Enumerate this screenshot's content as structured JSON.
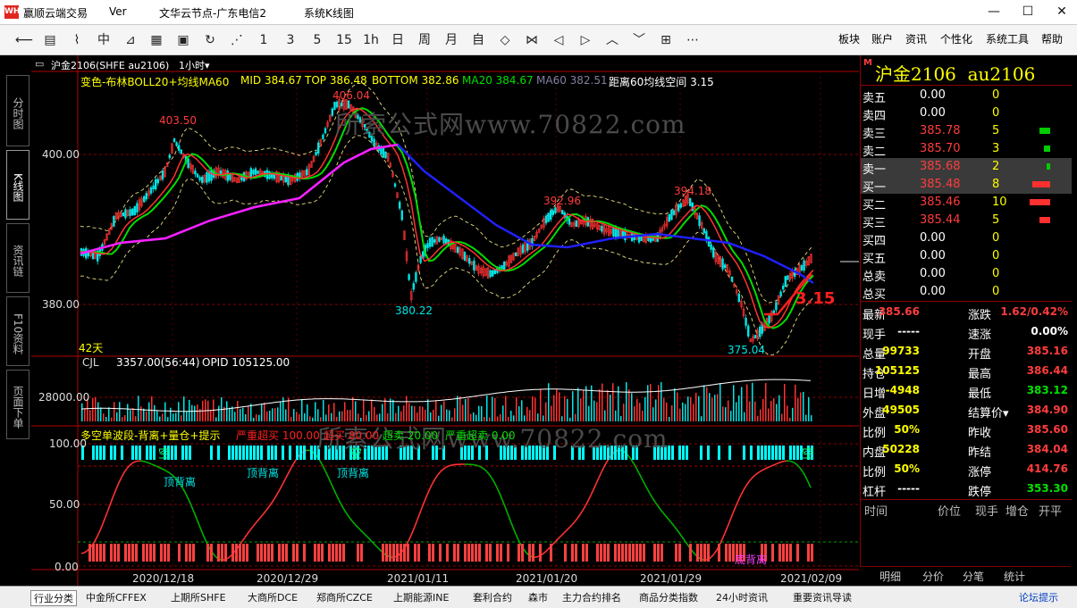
{
  "window": {
    "app_name": "赢顺云端交易",
    "version": "Ver",
    "node": "文华云节点-广东电信2",
    "view": "系统K线图",
    "logo": "WH6"
  },
  "toolbar": {
    "icons": [
      "back-icon",
      "list-icon",
      "line-chart-icon",
      "candle-icon",
      "chart-tool-icon",
      "grid-table-icon",
      "save-icon",
      "refresh-icon",
      "strategy-icon"
    ],
    "periods": [
      "1",
      "3",
      "5",
      "15",
      "1h",
      "日",
      "周",
      "月",
      "自"
    ],
    "nav_icons": [
      "zoom-in-icon",
      "zoom-out-icon",
      "left-icon",
      "right-icon",
      "up-icon",
      "down-icon",
      "layout-icon",
      "more-icon"
    ],
    "more": "⋯",
    "menus": [
      "板块",
      "账户",
      "资讯",
      "个性化",
      "系统工具",
      "帮助"
    ]
  },
  "left_tabs": [
    {
      "label": "分时图"
    },
    {
      "label": "K线图",
      "active": true
    },
    {
      "label": "资讯链"
    },
    {
      "label": "F10资料"
    },
    {
      "label": "页面下单"
    }
  ],
  "chart_header": {
    "symbol": "沪金2106(SHFE au2106)",
    "period": "1小时▾"
  },
  "indicator_line": {
    "name": "变色-布林BOLL20+均线MA60",
    "mid": "MID 384.67",
    "top": "TOP 386.48",
    "bottom": "BOTTOM 382.86",
    "ma20": "MA20 384.67",
    "ma60": "MA60 382.51",
    "dist": "距离60均线空间 3.15"
  },
  "annotations": {
    "p1": "403.50",
    "p2": "406.04",
    "p3": "392.96",
    "p4": "394.18",
    "l1": "380.22",
    "l2": "375.04",
    "dist_big": "3.15",
    "days": "42天"
  },
  "price_axis": [
    "400.00",
    "380.00"
  ],
  "vol_header": {
    "name": "CJL",
    "value": "3357.00(56:44)",
    "opid": "OPID 105125.00"
  },
  "vol_axis": "28000.00",
  "osc_header": {
    "name": "多空单波段-背离+量仓+提示",
    "t1": "严重超买 100.00",
    "t2": "超买 80.00",
    "t3": "超卖 20.00",
    "t4": "严重超卖 0.00"
  },
  "osc_axis": [
    "100.00",
    "50.00",
    "0.00"
  ],
  "osc_labels": {
    "kong": "空",
    "div_top": "顶背离",
    "div_bot": "底背离"
  },
  "date_axis": [
    "2020/12/18",
    "2020/12/29",
    "2021/01/11",
    "2021/01/20",
    "2021/01/29",
    "2021/02/09"
  ],
  "watermark": "所索公式网www.70822.com",
  "quote": {
    "symbol": "沪金2106  au2106",
    "marker": "M",
    "book": [
      {
        "label": "卖五",
        "price": "0.00",
        "vol": "0",
        "bar": 0
      },
      {
        "label": "卖四",
        "price": "0.00",
        "vol": "0",
        "bar": 0
      },
      {
        "label": "卖三",
        "price": "385.78",
        "vol": "5",
        "bar": 0.6
      },
      {
        "label": "卖二",
        "price": "385.70",
        "vol": "3",
        "bar": 0.35
      },
      {
        "label": "卖一",
        "price": "385.68",
        "vol": "2",
        "bar": 0.22
      },
      {
        "label": "买一",
        "price": "385.48",
        "vol": "8",
        "bar": 1.0
      },
      {
        "label": "买二",
        "price": "385.46",
        "vol": "10",
        "bar": 1.15
      },
      {
        "label": "买三",
        "price": "385.44",
        "vol": "5",
        "bar": 0.6
      },
      {
        "label": "买四",
        "price": "0.00",
        "vol": "0",
        "bar": 0
      },
      {
        "label": "买五",
        "price": "0.00",
        "vol": "0",
        "bar": 0
      },
      {
        "label": "总卖",
        "price": "0.00",
        "vol": "0",
        "bar": 0
      },
      {
        "label": "总买",
        "price": "0.00",
        "vol": "0",
        "bar": 0
      }
    ],
    "stats": [
      [
        "最新",
        "385.66",
        "涨跌",
        "1.62/0.42%"
      ],
      [
        "现手",
        "-----",
        "速涨",
        "0.00%"
      ],
      [
        "总量",
        "99733",
        "开盘",
        "385.16"
      ],
      [
        "持仓",
        "105125",
        "最高",
        "386.44"
      ],
      [
        "日增",
        "-4948",
        "最低",
        "383.12"
      ],
      [
        "外盘",
        "49505",
        "结算价▾",
        "384.90"
      ],
      [
        "比例",
        "50%",
        "昨收",
        "385.60"
      ],
      [
        "内盘",
        "50228",
        "昨结",
        "384.04"
      ],
      [
        "比例",
        "50%",
        "涨停",
        "414.76"
      ],
      [
        "杠杆",
        "-----",
        "跌停",
        "353.30"
      ]
    ],
    "tick_header": [
      "时间",
      "价位",
      "现手",
      "增仓",
      "开平"
    ],
    "bottom_tabs": [
      "明细",
      "分价",
      "分笔",
      "统计"
    ]
  },
  "colors": {
    "up": "#ff3232",
    "down": "#00e5e5",
    "ma20": "#00dd00",
    "ma60": "#2020ff",
    "mid": "#ff20ff",
    "boll": "#e8e080",
    "yellow": "#ffff00",
    "price_red": "#ff3c3c",
    "price_green": "#00e000",
    "cyan": "#00ffff"
  },
  "bottom_bar": [
    "行业分类",
    "中金所CFFEX",
    "上期所SHFE",
    "大商所DCE",
    "郑商所CZCE",
    "上期能源INE",
    "套利合约",
    "森市",
    "主力合约排名",
    "商品分类指数",
    "24小时资讯",
    "重要资讯导读"
  ],
  "bottom_right": "论坛提示"
}
